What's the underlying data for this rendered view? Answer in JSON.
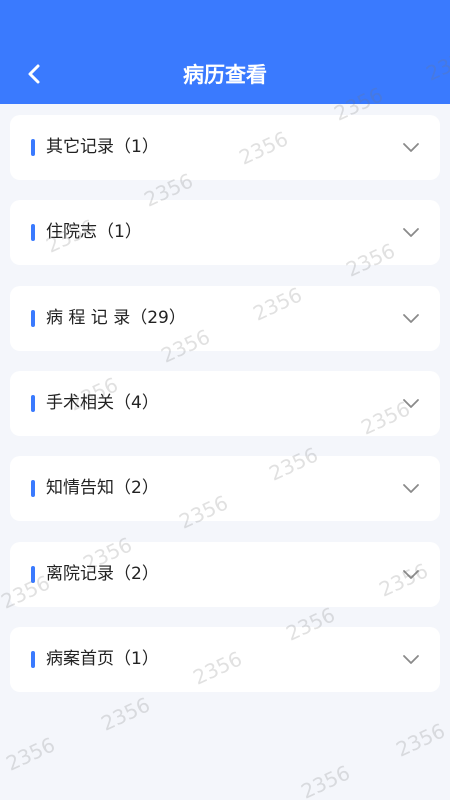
{
  "header": {
    "title": "病历查看"
  },
  "sections": [
    {
      "label": "其它记录（1）"
    },
    {
      "label": "住院志（1）"
    },
    {
      "label": "病 程 记 录（29）"
    },
    {
      "label": "手术相关（4）"
    },
    {
      "label": "知情告知（2）"
    },
    {
      "label": "离院记录（2）"
    },
    {
      "label": "病案首页（1）"
    }
  ],
  "watermark": {
    "text": "2356"
  },
  "colors": {
    "primary": "#3a7afe",
    "background": "#f4f6fb",
    "card": "#ffffff"
  },
  "icons": {
    "back": "chevron-left-icon",
    "expand": "chevron-down-icon"
  }
}
